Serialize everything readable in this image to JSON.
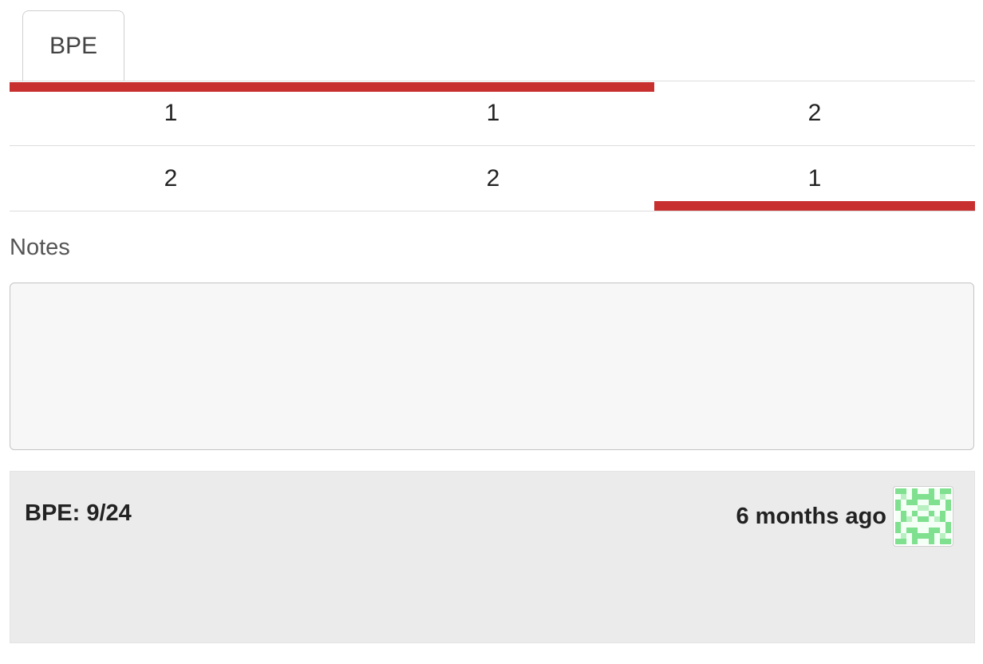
{
  "tabs": [
    {
      "label": "BPE",
      "active": true
    }
  ],
  "score_grid": {
    "rows": [
      [
        "1",
        "1",
        "2"
      ],
      [
        "2",
        "2",
        "1"
      ]
    ],
    "accent_color": "#c8302f"
  },
  "notes": {
    "label": "Notes",
    "value": "",
    "placeholder": ""
  },
  "comment": {
    "text": "BPE: 9/24",
    "time": "6 months ago",
    "avatar_icon": "identicon-avatar-icon",
    "avatar_color": "#7fe08f"
  }
}
